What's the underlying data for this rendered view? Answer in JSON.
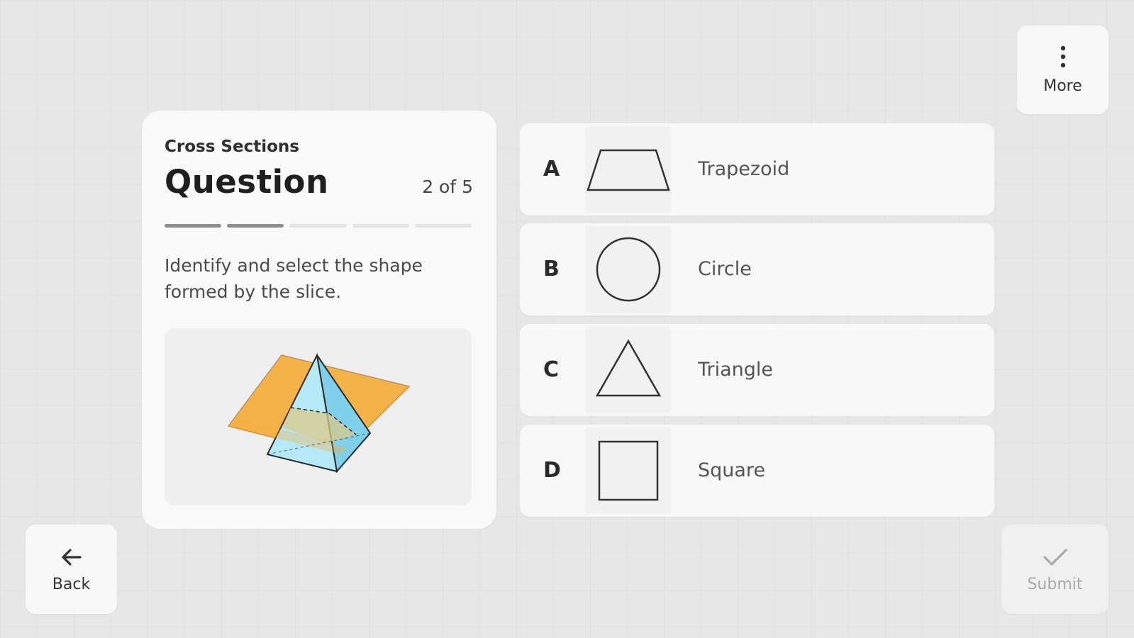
{
  "toolbar": {
    "more_label": "More",
    "back_label": "Back",
    "submit_label": "Submit",
    "more_icon": "more-vertical-icon",
    "back_icon": "arrow-left-icon",
    "submit_icon": "check-icon"
  },
  "question": {
    "subject": "Cross Sections",
    "title": "Question",
    "progress_text": "2 of 5",
    "progress": {
      "current": 2,
      "total": 5
    },
    "prompt": "Identify and select the shape formed by the slice.",
    "figure_icon": "pyramid-cross-section-figure"
  },
  "answers": [
    {
      "letter": "A",
      "label": "Trapezoid",
      "shape": "trapezoid"
    },
    {
      "letter": "B",
      "label": "Circle",
      "shape": "circle"
    },
    {
      "letter": "C",
      "label": "Triangle",
      "shape": "triangle"
    },
    {
      "letter": "D",
      "label": "Square",
      "shape": "square"
    }
  ],
  "colors": {
    "background": "#e7e7e7",
    "card": "#f9f9f9",
    "plane": "#f5b041",
    "pyramid": "#a8e4f5",
    "pyramid_shade": "#6fcbe8",
    "outline": "#2a2a2a"
  }
}
